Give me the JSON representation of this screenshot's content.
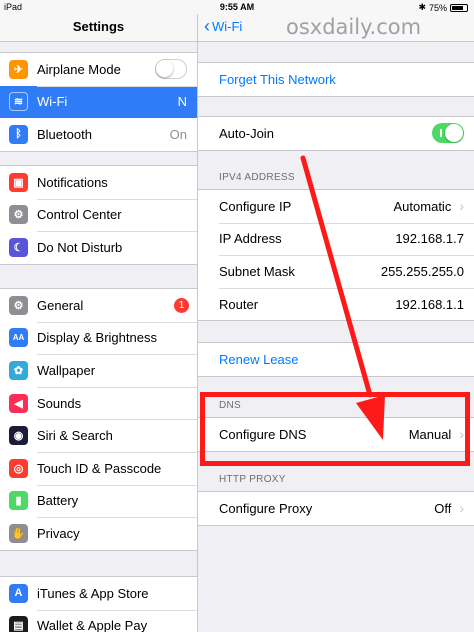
{
  "status": {
    "device": "iPad",
    "time": "9:55 AM",
    "battery": "75%"
  },
  "left": {
    "title": "Settings",
    "groups": [
      [
        {
          "label": "Airplane Mode",
          "icon": "airplane-icon",
          "color": "#ff9500",
          "control": "toggle-off"
        },
        {
          "label": "Wi-Fi",
          "icon": "wifi-icon",
          "color": "#2f7cf6",
          "value": "N",
          "selected": true
        },
        {
          "label": "Bluetooth",
          "icon": "bluetooth-icon",
          "color": "#2f7cf6",
          "value": "On"
        }
      ],
      [
        {
          "label": "Notifications",
          "icon": "notifications-icon",
          "color": "#ff3b30"
        },
        {
          "label": "Control Center",
          "icon": "control-center-icon",
          "color": "#8e8e93"
        },
        {
          "label": "Do Not Disturb",
          "icon": "moon-icon",
          "color": "#5856d6"
        }
      ],
      [
        {
          "label": "General",
          "icon": "gear-icon",
          "color": "#8e8e93",
          "badge": "1"
        },
        {
          "label": "Display & Brightness",
          "icon": "display-icon",
          "color": "#2f7cf6"
        },
        {
          "label": "Wallpaper",
          "icon": "wallpaper-icon",
          "color": "#34aadc"
        },
        {
          "label": "Sounds",
          "icon": "sounds-icon",
          "color": "#ff2d55"
        },
        {
          "label": "Siri & Search",
          "icon": "siri-icon",
          "color": "#1c1c3a"
        },
        {
          "label": "Touch ID & Passcode",
          "icon": "fingerprint-icon",
          "color": "#ff3b30"
        },
        {
          "label": "Battery",
          "icon": "battery-icon",
          "color": "#4cd964"
        },
        {
          "label": "Privacy",
          "icon": "hand-icon",
          "color": "#8e8e93"
        }
      ],
      [
        {
          "label": "iTunes & App Store",
          "icon": "app-store-icon",
          "color": "#2f7cf6"
        },
        {
          "label": "Wallet & Apple Pay",
          "icon": "wallet-icon",
          "color": "#1c1c1e"
        }
      ]
    ]
  },
  "right": {
    "back_label": "Wi-Fi",
    "watermark": "osxdaily.com",
    "forget_label": "Forget This Network",
    "autojoin_label": "Auto-Join",
    "ipv4_header": "IPV4 ADDRESS",
    "ipv4_rows": [
      {
        "key": "Configure IP",
        "value": "Automatic",
        "chevron": true
      },
      {
        "key": "IP Address",
        "value": "192.168.1.7"
      },
      {
        "key": "Subnet Mask",
        "value": "255.255.255.0"
      },
      {
        "key": "Router",
        "value": "192.168.1.1"
      }
    ],
    "renew_label": "Renew Lease",
    "dns_header": "DNS",
    "configure_dns_label": "Configure DNS",
    "configure_dns_value": "Manual",
    "proxy_header": "HTTP PROXY",
    "configure_proxy_label": "Configure Proxy",
    "configure_proxy_value": "Off"
  },
  "annotation_color": "#ff1a1a"
}
